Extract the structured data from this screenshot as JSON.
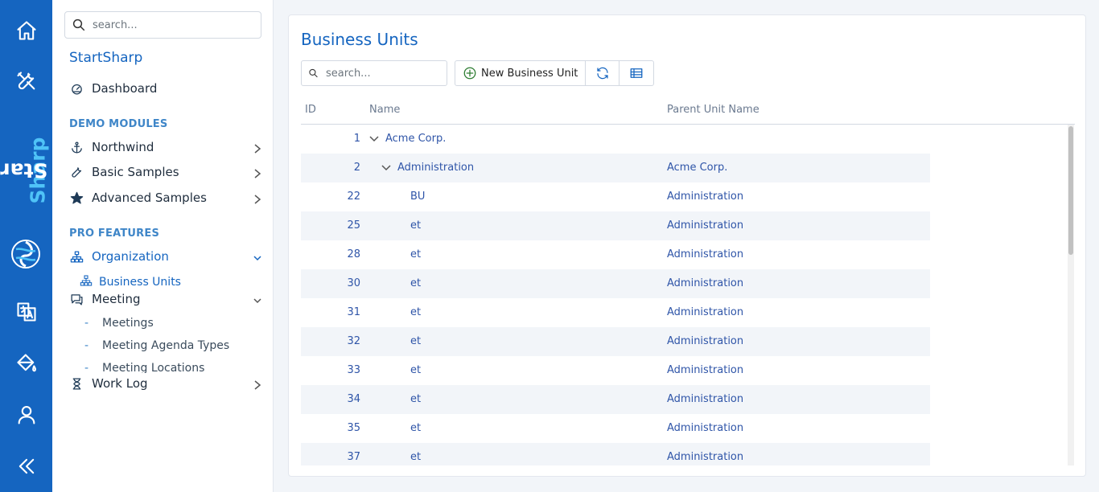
{
  "rail": {
    "brand_prefix": "Start",
    "brand_suffix": "Sharp",
    "icons": [
      "home-icon",
      "tools-icon",
      "translate-icon",
      "paint-bucket-icon",
      "user-icon",
      "collapse-icon"
    ]
  },
  "sidebar": {
    "search_placeholder": "search...",
    "title": "StartSharp",
    "dashboard": "Dashboard",
    "demo_header": "DEMO MODULES",
    "demo_items": [
      "Northwind",
      "Basic Samples",
      "Advanced Samples"
    ],
    "pro_header": "PRO FEATURES",
    "organization": "Organization",
    "business_units": "Business Units",
    "meeting": "Meeting",
    "meeting_children": [
      "Meetings",
      "Meeting Agenda Types",
      "Meeting Locations"
    ],
    "work_log": "Work Log"
  },
  "main": {
    "title": "Business Units",
    "search_placeholder": "search...",
    "new_button": "New Business Unit",
    "columns": [
      "ID",
      "Name",
      "Parent Unit Name"
    ],
    "rows": [
      {
        "id": "1",
        "name": "Acme Corp.",
        "parent": "",
        "level": 0,
        "expanded": true
      },
      {
        "id": "2",
        "name": "Administration",
        "parent": "Acme Corp.",
        "level": 1,
        "expanded": true
      },
      {
        "id": "22",
        "name": "BU",
        "parent": "Administration",
        "level": 2
      },
      {
        "id": "25",
        "name": "et",
        "parent": "Administration",
        "level": 2
      },
      {
        "id": "28",
        "name": "et",
        "parent": "Administration",
        "level": 2
      },
      {
        "id": "30",
        "name": "et",
        "parent": "Administration",
        "level": 2
      },
      {
        "id": "31",
        "name": "et",
        "parent": "Administration",
        "level": 2
      },
      {
        "id": "32",
        "name": "et",
        "parent": "Administration",
        "level": 2
      },
      {
        "id": "33",
        "name": "et",
        "parent": "Administration",
        "level": 2
      },
      {
        "id": "34",
        "name": "et",
        "parent": "Administration",
        "level": 2
      },
      {
        "id": "35",
        "name": "et",
        "parent": "Administration",
        "level": 2
      },
      {
        "id": "37",
        "name": "et",
        "parent": "Administration",
        "level": 2
      }
    ]
  },
  "colors": {
    "rail": "#1565c0",
    "accent": "#1565c0",
    "link": "#2f55a8",
    "section": "#3f86c8",
    "alt_row": "#f2f5f9",
    "add_icon": "#2e7d32"
  }
}
